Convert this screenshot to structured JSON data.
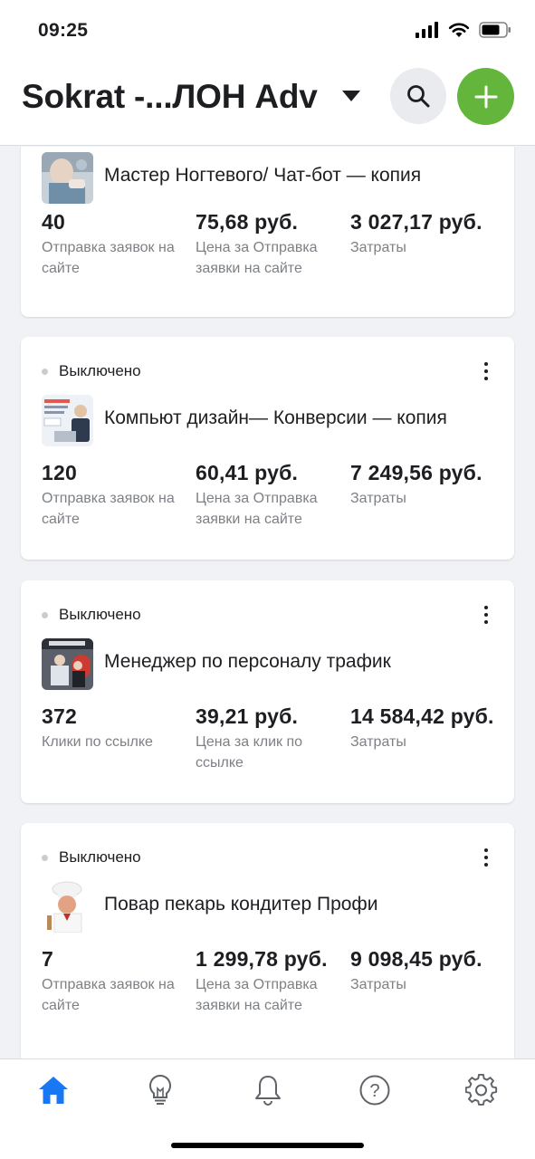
{
  "status_bar": {
    "time": "09:25"
  },
  "header": {
    "account_title": "Sokrat -...ЛОН Adv"
  },
  "colors": {
    "accent_green": "#64b53c",
    "tab_active_blue": "#1877f2"
  },
  "ads": [
    {
      "status": "",
      "name": "Мастер Ногтевого/ Чат-бот — копия",
      "metrics": [
        {
          "value": "40",
          "label": "Отправка заявок на сайте"
        },
        {
          "value": "75,68 руб.",
          "label": "Цена за Отправка заявки на сайте"
        },
        {
          "value": "3 027,17 руб.",
          "label": "Затраты"
        }
      ]
    },
    {
      "status": "Выключено",
      "name": "Компьют дизайн— Конверсии — копия",
      "metrics": [
        {
          "value": "120",
          "label": "Отправка заявок на сайте"
        },
        {
          "value": "60,41 руб.",
          "label": "Цена за Отправка заявки на сайте"
        },
        {
          "value": "7 249,56 руб.",
          "label": "Затраты"
        }
      ]
    },
    {
      "status": "Выключено",
      "name": "Менеджер по персоналу трафик",
      "metrics": [
        {
          "value": "372",
          "label": "Клики по ссылке"
        },
        {
          "value": "39,21 руб.",
          "label": "Цена за клик по ссылке"
        },
        {
          "value": "14 584,42 руб.",
          "label": "Затраты"
        }
      ]
    },
    {
      "status": "Выключено",
      "name": "Повар пекарь кондитер Профи",
      "metrics": [
        {
          "value": "7",
          "label": "Отправка заявок на сайте"
        },
        {
          "value": "1 299,78 руб.",
          "label": "Цена за Отправка заявки на сайте"
        },
        {
          "value": "9 098,45 руб.",
          "label": "Затраты"
        }
      ]
    }
  ],
  "tabs": [
    {
      "icon": "home-icon",
      "active": true
    },
    {
      "icon": "lightbulb-icon",
      "active": false
    },
    {
      "icon": "bell-icon",
      "active": false
    },
    {
      "icon": "help-icon",
      "active": false
    },
    {
      "icon": "gear-icon",
      "active": false
    }
  ]
}
